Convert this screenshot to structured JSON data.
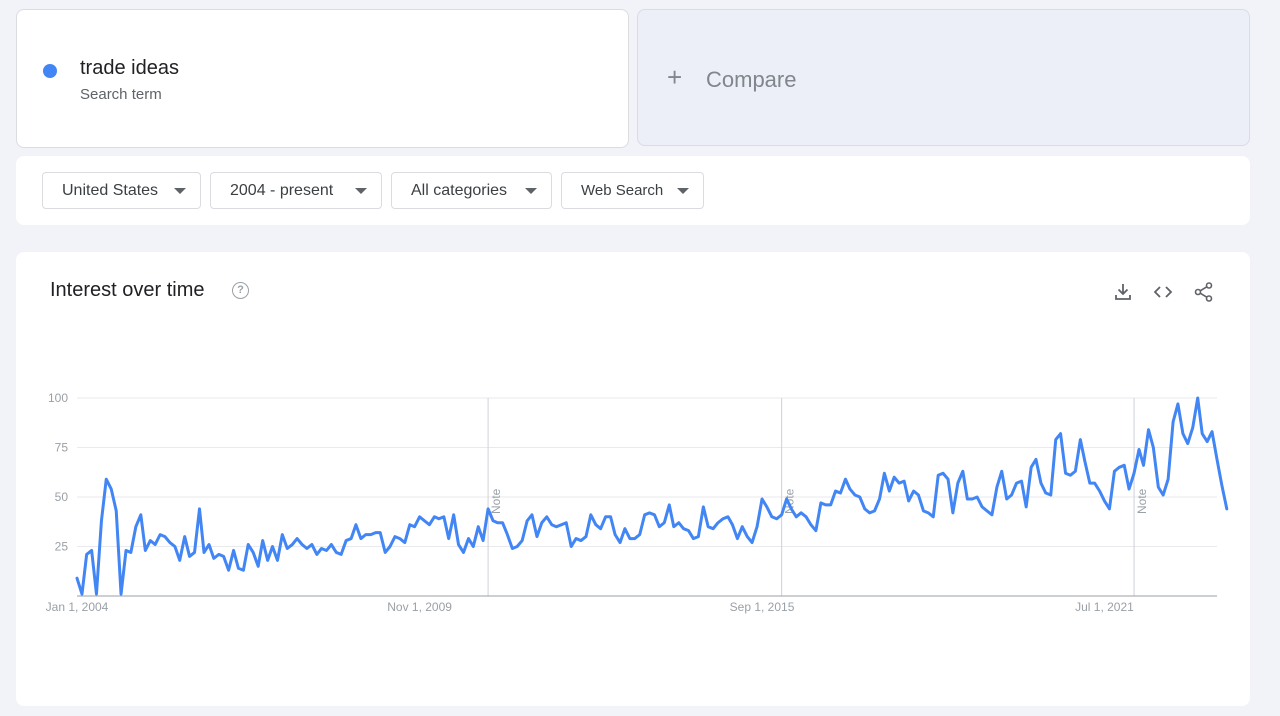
{
  "search_term": {
    "name": "trade ideas",
    "subtitle": "Search term",
    "color": "#4285f4"
  },
  "compare": {
    "plus": "+",
    "label": "Compare"
  },
  "filters": [
    {
      "label": "United States"
    },
    {
      "label": "2004 - present"
    },
    {
      "label": "All categories"
    },
    {
      "label": "Web Search"
    }
  ],
  "chart_card": {
    "title": "Interest over time",
    "help_glyph": "?"
  },
  "chart_data": {
    "type": "line",
    "title": "Interest over time",
    "xlabel": "",
    "ylabel": "",
    "ylim": [
      0,
      100
    ],
    "yticks": [
      25,
      50,
      75,
      100
    ],
    "grid": true,
    "x_start": "2004-01-01",
    "x_end": "2023-06-01",
    "x_ticks": [
      {
        "date": "2004-01-01",
        "label": "Jan 1, 2004"
      },
      {
        "date": "2009-11-01",
        "label": "Nov 1, 2009"
      },
      {
        "date": "2015-09-01",
        "label": "Sep 1, 2015"
      },
      {
        "date": "2021-07-01",
        "label": "Jul 1, 2021"
      }
    ],
    "notes": [
      {
        "date": "2011-01-01",
        "label": "Note"
      },
      {
        "date": "2016-01-01",
        "label": "Note"
      },
      {
        "date": "2022-01-01",
        "label": "Note"
      }
    ],
    "series": [
      {
        "color": "#4285f4",
        "x_step": "month",
        "values": [
          9,
          1,
          21,
          23,
          1,
          38,
          59,
          54,
          43,
          1,
          23,
          22,
          35,
          41,
          23,
          28,
          26,
          31,
          30,
          27,
          25,
          18,
          30,
          20,
          22,
          44,
          22,
          26,
          19,
          21,
          20,
          13,
          23,
          14,
          13,
          26,
          22,
          15,
          28,
          18,
          25,
          18,
          31,
          24,
          26,
          29,
          26,
          24,
          26,
          21,
          24,
          23,
          26,
          22,
          21,
          28,
          29,
          36,
          29,
          31,
          31,
          32,
          32,
          22,
          25,
          30,
          29,
          27,
          36,
          35,
          40,
          38,
          36,
          40,
          39,
          40,
          29,
          41,
          26,
          22,
          29,
          25,
          35,
          28,
          44,
          38,
          37,
          37,
          31,
          24,
          25,
          28,
          38,
          41,
          30,
          37,
          40,
          36,
          35,
          36,
          37,
          25,
          29,
          28,
          30,
          41,
          36,
          34,
          40,
          40,
          31,
          27,
          34,
          29,
          29,
          31,
          41,
          42,
          41,
          35,
          37,
          46,
          35,
          37,
          34,
          33,
          29,
          30,
          45,
          35,
          34,
          37,
          39,
          40,
          36,
          29,
          35,
          30,
          27,
          35,
          49,
          45,
          40,
          39,
          41,
          49,
          44,
          40,
          42,
          40,
          36,
          33,
          47,
          46,
          46,
          53,
          52,
          59,
          54,
          51,
          50,
          44,
          42,
          43,
          49,
          62,
          53,
          60,
          57,
          58,
          48,
          53,
          51,
          43,
          42,
          40,
          61,
          62,
          59,
          42,
          57,
          63,
          49,
          49,
          50,
          45,
          43,
          41,
          55,
          63,
          49,
          51,
          57,
          58,
          45,
          65,
          69,
          57,
          52,
          51,
          79,
          82,
          62,
          61,
          63,
          79,
          68,
          57,
          57,
          53,
          48,
          44,
          63,
          65,
          66,
          54,
          62,
          74,
          66,
          84,
          75,
          55,
          51,
          59,
          88,
          97,
          82,
          77,
          85,
          100,
          82,
          78,
          83,
          69,
          56,
          44
        ]
      }
    ]
  },
  "icons": {
    "download": "download-icon",
    "embed": "embed-code-icon",
    "share": "share-icon",
    "help": "help-circle-icon"
  }
}
